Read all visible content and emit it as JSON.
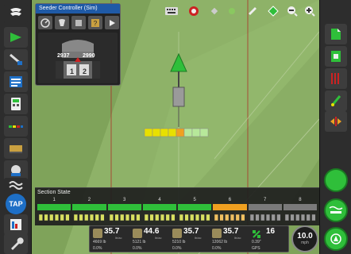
{
  "seeder": {
    "title": "Seeder Controller (Sim)",
    "left_count": "2937",
    "right_count": "2990",
    "tank_labels": [
      "1",
      "2"
    ]
  },
  "sections": {
    "title": "Section State",
    "numbers": [
      "1",
      "2",
      "3",
      "4",
      "5",
      "6",
      "7",
      "8"
    ],
    "states": [
      "on",
      "on",
      "on",
      "on",
      "on",
      "override",
      "off",
      "off"
    ]
  },
  "stats": [
    {
      "value": "35.7",
      "unit": "lb/ac",
      "line1": "4669 lb",
      "line2": "0.0%",
      "icon": "seed-bag-icon"
    },
    {
      "value": "44.6",
      "unit": "lb/ac",
      "line1": "5121 lb",
      "line2": "0.0%",
      "icon": "seed-bag-icon"
    },
    {
      "value": "35.7",
      "unit": "lb/ac",
      "line1": "5210 lb",
      "line2": "0.0%",
      "icon": "seed-bag-icon"
    },
    {
      "value": "35.7",
      "unit": "lb/ac",
      "line1": "12062 lb",
      "line2": "0.0%",
      "icon": "seed-bag-icon"
    }
  ],
  "gps": {
    "sat_count": "16",
    "line1": "0.39\"",
    "line2": "GPS"
  },
  "speed": {
    "value": "10.0",
    "unit": "mph"
  },
  "tap_label": "TAP",
  "colors": {
    "field": "#7fa35a",
    "worked": "#5a8b3a",
    "accent_green": "#2fbf3a",
    "section_yellow": "#e8e000",
    "section_orange": "#f0a020",
    "section_light": "#b7e89a"
  }
}
